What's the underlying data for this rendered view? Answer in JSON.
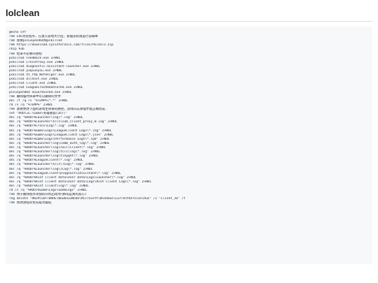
{
  "document": {
    "title": "lolclean"
  },
  "code": {
    "language": "batch",
    "lines": [
      "@echo off",
      "rem LOL优化程序，在进入游戏大厅后，管理员权限运行该脚本",
      "rem 需要pssuspend64和pskill64",
      "rem https://download.sysinternals.com/files/PSTools.zip",
      "chcp 936",
      "rem 结束不必要的进程",
      "pskill64 FeedBack.exe 2>NUL",
      "pskill64 CrossProxy.exe 2>NUL",
      "pskill64 diagnostic-assistant-launcher.exe 2>NUL",
      "pskill64 yxqxunyou.exe 2>NUL",
      "pskill64 XY_YXQ_Nethelper.exe 2>NUL",
      "pskill64 dllhost.exe 2>NUL",
      "pskill64 Client.exe 2>NUL",
      "pskill64 LeagueCrashHandler64.exe 2>NUL",
      "pssuspend64 SGuardSvc64.exe 2>NUL",
      "rem 删除临时目录中可以删除的文件",
      "del /f /q /s \"%TEMP%\\*.*\" 2>NUL",
      "rd /s /q \"%TEMP%\" 2>NUL",
      "rem 需要更改下面的游戏主目录的路径，游戏日志清理才能正确完成.",
      "set \"ROOT=E:\\Game\\英雄联盟(26)\\\"",
      "del /q \"%ROOT%Launcher\\log\\*.log\" 2>NUL",
      "del /q \"%ROOT%Launcher\\tcls\\sub_client_proxy_0.log\" 2>NUL",
      "del /q \"%ROOT%Cross\\Log\\*.log\" 2>NUL",
      "del /q \"%ROOT%Game\\Logs\\LeagueClient Logs\\*.log\" 2>NUL",
      "del /q \"%ROOT%Game\\Logs\\LeagueClient Logs\\*.json\" 2>NUL",
      "del /q \"%ROOT%Game\\Logs\\Performance Logs\\*.rpd\" 2>NUL",
      "del /q \"%ROOT%Launcher\\log\\comm_auth_log\\*.log\" 2>NUL",
      "del /q \"%ROOT%Launcher\\log\\sail\\Client\\*.log\" 2>NUL",
      "del /q \"%ROOT%Launcher\\log\\tcls\\log\\*.log\" 2>NUL",
      "del /q \"%ROOT%Launcher\\log\\tinyget\\*.log\" 2>NUL",
      "del /q \"%ROOT%LeagueClient\\*.log\" 2>NUL",
      "del /q \"%ROOT%Launcher\\tcls\\TLog\\*.log\" 2>NUL",
      "del /q \"%ROOT%Launcher\\log\\TLog\\*.log\" 2>NUL",
      "del /q \"%ROOT%LeagueClient\\DiagnosticAssistant\\*.log\" 2>NUL",
      "del /q \"%ROOT%Riot Client Data\\User Data\\Logs\\Launcher\\*.log\" 2>NUL",
      "del /q \"%ROOT%Riot Client Data\\User Data\\Logs\\Riot Client Logs\\*.log\" 2>NUL",
      "del /q \"%ROOT%Riot Client\\log\\*.log\" 2>NUL",
      "rd /s /q \"%ROOT%Game\\Logs\\GameLogs\" 2>NUL",
      "rem 用于删除程序添加的开机启动项(腾讯是真的恶心)",
      "reg delete \"HKLM\\SOFTWARE\\Wow6432Node\\Microsoft\\Windows\\CurrentVersion\\Run\" /v \"Client_26\" /f",
      "rem 修改进程的优先级为最低"
    ]
  }
}
